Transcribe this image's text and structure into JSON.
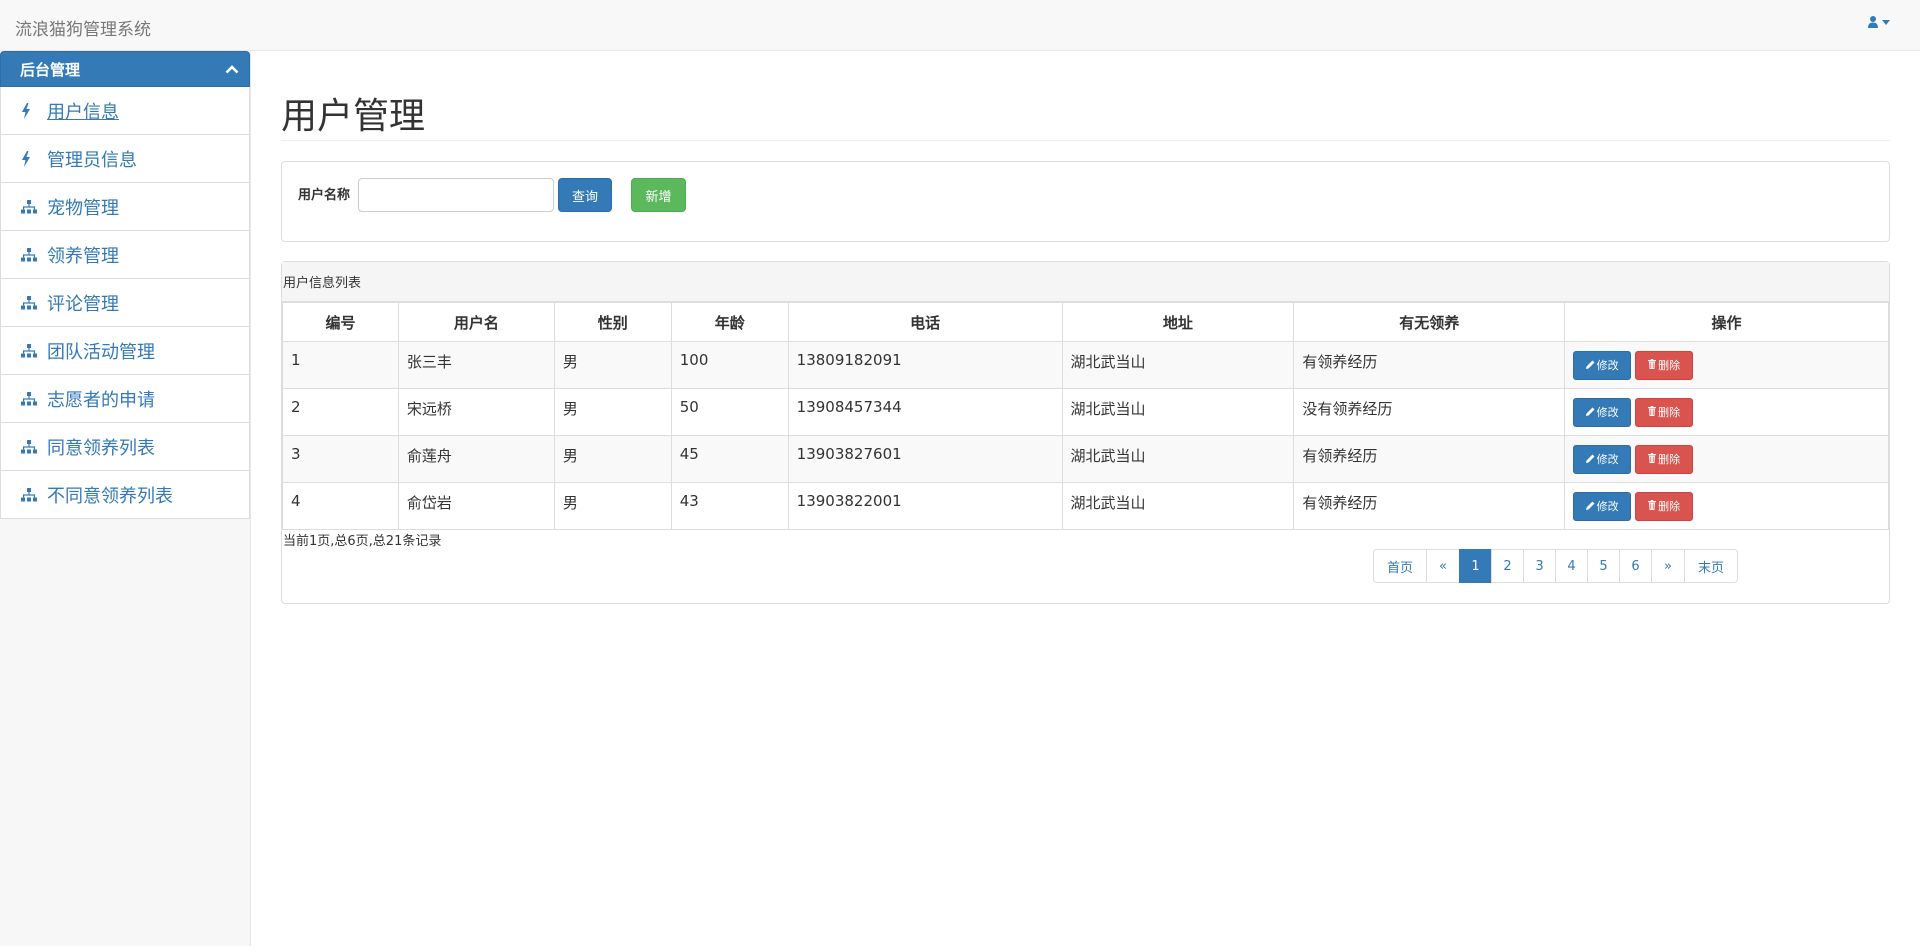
{
  "app": {
    "title": "流浪猫狗管理系统"
  },
  "sidebar": {
    "header": "后台管理",
    "items": [
      {
        "label": "用户信息",
        "icon": "bolt-icon"
      },
      {
        "label": "管理员信息",
        "icon": "bolt-icon"
      },
      {
        "label": "宠物管理",
        "icon": "sitemap-icon"
      },
      {
        "label": "领养管理",
        "icon": "sitemap-icon"
      },
      {
        "label": "评论管理",
        "icon": "sitemap-icon"
      },
      {
        "label": "团队活动管理",
        "icon": "sitemap-icon"
      },
      {
        "label": "志愿者的申请",
        "icon": "sitemap-icon"
      },
      {
        "label": "同意领养列表",
        "icon": "sitemap-icon"
      },
      {
        "label": "不同意领养列表",
        "icon": "sitemap-icon"
      }
    ]
  },
  "page": {
    "title": "用户管理"
  },
  "search": {
    "label": "用户名称",
    "value": "",
    "query_label": "查询",
    "add_label": "新增"
  },
  "table": {
    "heading": "用户信息列表",
    "columns": [
      "编号",
      "用户名",
      "性别",
      "年龄",
      "电话",
      "地址",
      "有无领养",
      "操作"
    ],
    "rows": [
      [
        "1",
        "张三丰",
        "男",
        "100",
        "13809182091",
        "湖北武当山",
        "有领养经历"
      ],
      [
        "2",
        "宋远桥",
        "男",
        "50",
        "13908457344",
        "湖北武当山",
        "没有领养经历"
      ],
      [
        "3",
        "俞莲舟",
        "男",
        "45",
        "13903827601",
        "湖北武当山",
        "有领养经历"
      ],
      [
        "4",
        "俞岱岩",
        "男",
        "43",
        "13903822001",
        "湖北武当山",
        "有领养经历"
      ]
    ],
    "edit_label": "修改",
    "delete_label": "删除"
  },
  "pager": {
    "info": "当前1页,总6页,总21条记录",
    "first": "首页",
    "prev": "«",
    "pages": [
      "1",
      "2",
      "3",
      "4",
      "5",
      "6"
    ],
    "current": "1",
    "next": "»",
    "last": "末页"
  },
  "colors": {
    "primary": "#337ab7",
    "success": "#5cb85c",
    "danger": "#d9534f"
  }
}
